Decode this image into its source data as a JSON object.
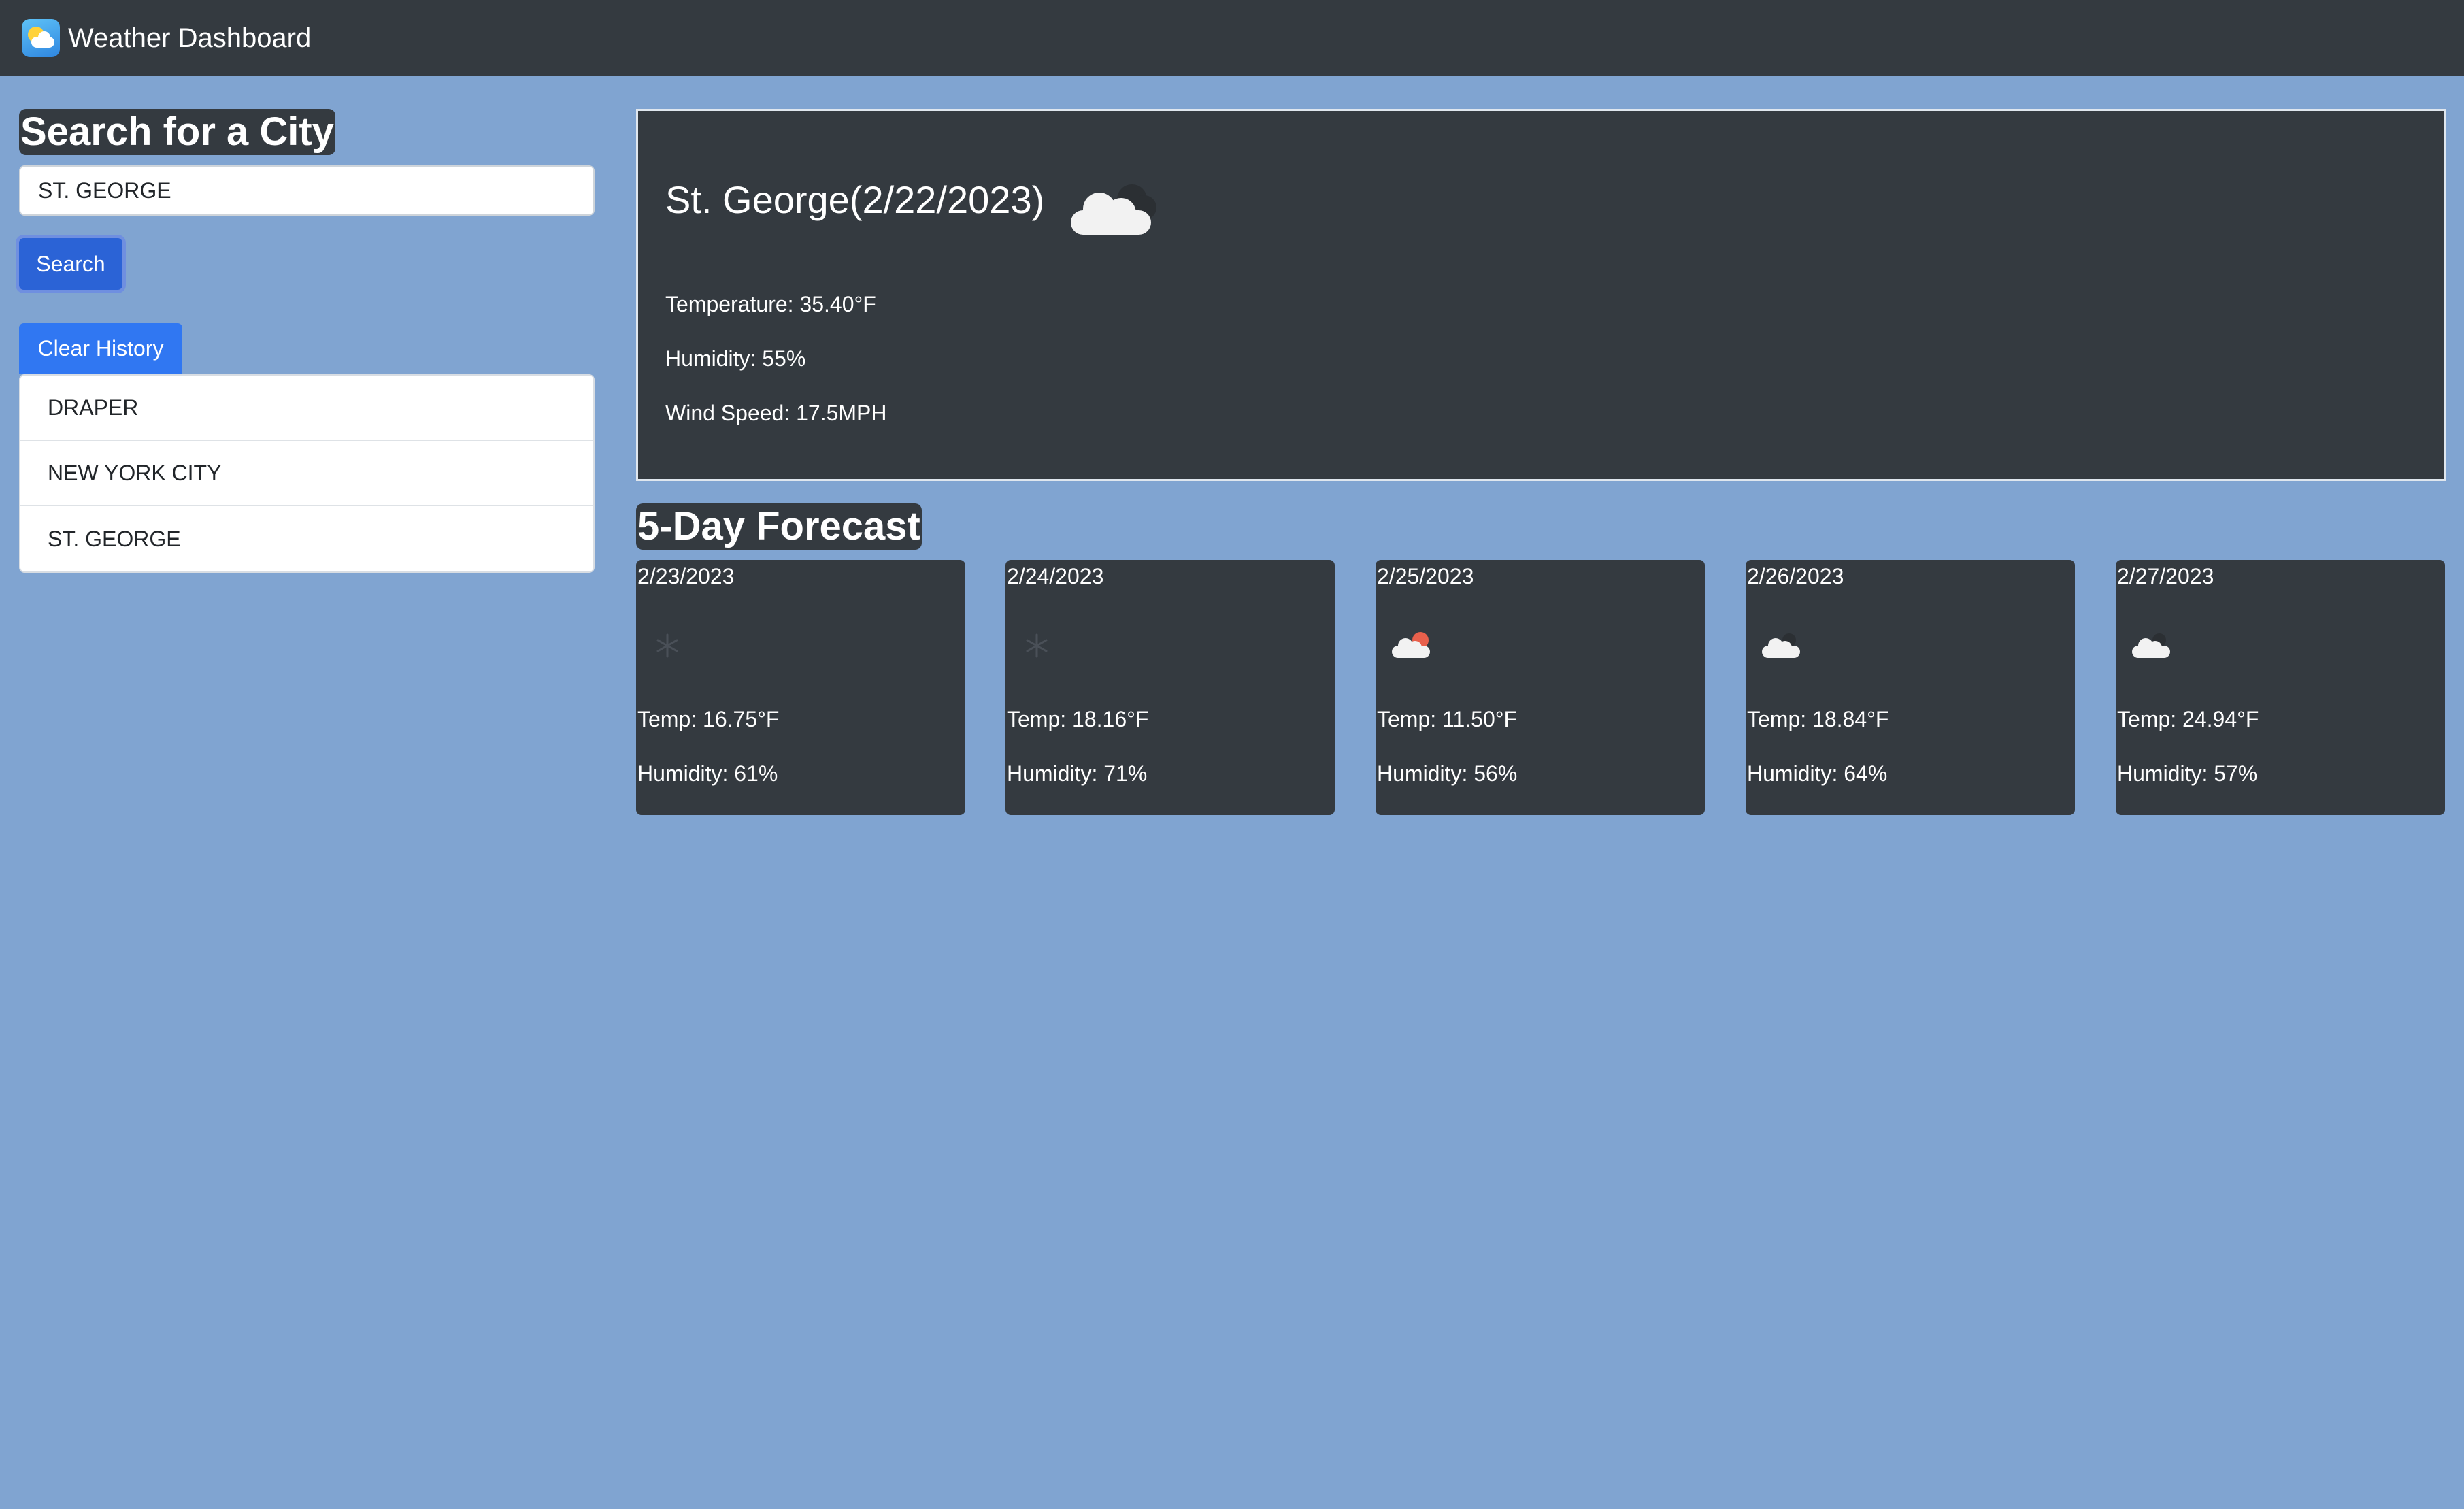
{
  "app": {
    "title": "Weather Dashboard",
    "icon": "weather-app-icon"
  },
  "sidebar": {
    "heading": "Search for a City",
    "search_value": "ST. GEORGE",
    "search_button": "Search",
    "clear_button": "Clear History",
    "history": [
      "DRAPER",
      "NEW YORK CITY",
      "ST. GEORGE"
    ]
  },
  "current": {
    "title": "St. George(2/22/2023)",
    "icon": "cloudy-icon",
    "temperature": "Temperature: 35.40°F",
    "humidity": "Humidity: 55%",
    "wind": "Wind Speed: 17.5MPH"
  },
  "forecast": {
    "heading": "5-Day Forecast",
    "days": [
      {
        "date": "2/23/2023",
        "icon": "snow-icon",
        "temp": "Temp: 16.75°F",
        "humidity": "Humidity: 61%"
      },
      {
        "date": "2/24/2023",
        "icon": "snow-icon",
        "temp": "Temp: 18.16°F",
        "humidity": "Humidity: 71%"
      },
      {
        "date": "2/25/2023",
        "icon": "partly-cloudy-icon",
        "temp": "Temp: 11.50°F",
        "humidity": "Humidity: 56%"
      },
      {
        "date": "2/26/2023",
        "icon": "cloudy-icon",
        "temp": "Temp: 18.84°F",
        "humidity": "Humidity: 64%"
      },
      {
        "date": "2/27/2023",
        "icon": "cloudy-icon",
        "temp": "Temp: 24.94°F",
        "humidity": "Humidity: 57%"
      }
    ]
  },
  "colors": {
    "background": "#80a4d1",
    "panel": "#343a40",
    "primary_button": "#2f6fe0"
  }
}
